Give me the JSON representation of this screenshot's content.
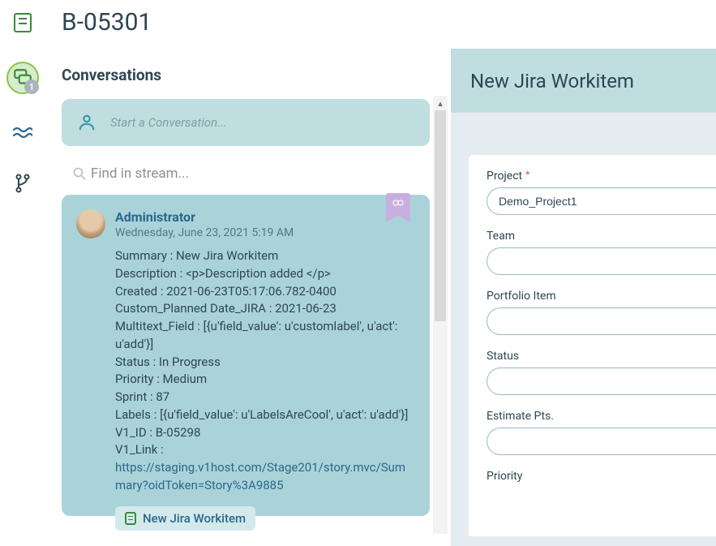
{
  "page": {
    "title": "B-05301",
    "section": "Conversations"
  },
  "rail": {
    "conversations_badge": "1"
  },
  "startConversation": {
    "placeholder": "Start a Conversation..."
  },
  "search": {
    "placeholder": "Find in stream..."
  },
  "card": {
    "author": "Administrator",
    "timestamp": "Wednesday, June 23, 2021 5:19 AM",
    "lines": [
      "Summary : New Jira Workitem",
      "Description : <p>Description added </p>",
      "Created : 2021-06-23T05:17:06.782-0400",
      "Custom_Planned Date_JIRA : 2021-06-23",
      "Multitext_Field : [{u'field_value': u'customlabel', u'act': u'add'}]",
      "Status : In Progress",
      "Priority : Medium",
      "Sprint : 87",
      "Labels : [{u'field_value': u'LabelsAreCool', u'act': u'add'}]",
      "V1_ID : B-05298"
    ],
    "link_prefix": "V1_Link : ",
    "link_text": "https://staging.v1host.com/Stage201/story.mvc/Summary?oidToken=Story%3A9885",
    "chip": "New Jira Workitem"
  },
  "panel": {
    "title": "New Jira Workitem",
    "fields": {
      "project": {
        "label": "Project",
        "required": true,
        "value": "Demo_Project1"
      },
      "team": {
        "label": "Team",
        "value": ""
      },
      "portfolio": {
        "label": "Portfolio Item",
        "value": ""
      },
      "status": {
        "label": "Status",
        "value": ""
      },
      "estimate": {
        "label": "Estimate Pts.",
        "value": ""
      },
      "priority": {
        "label": "Priority",
        "value": ""
      }
    }
  }
}
